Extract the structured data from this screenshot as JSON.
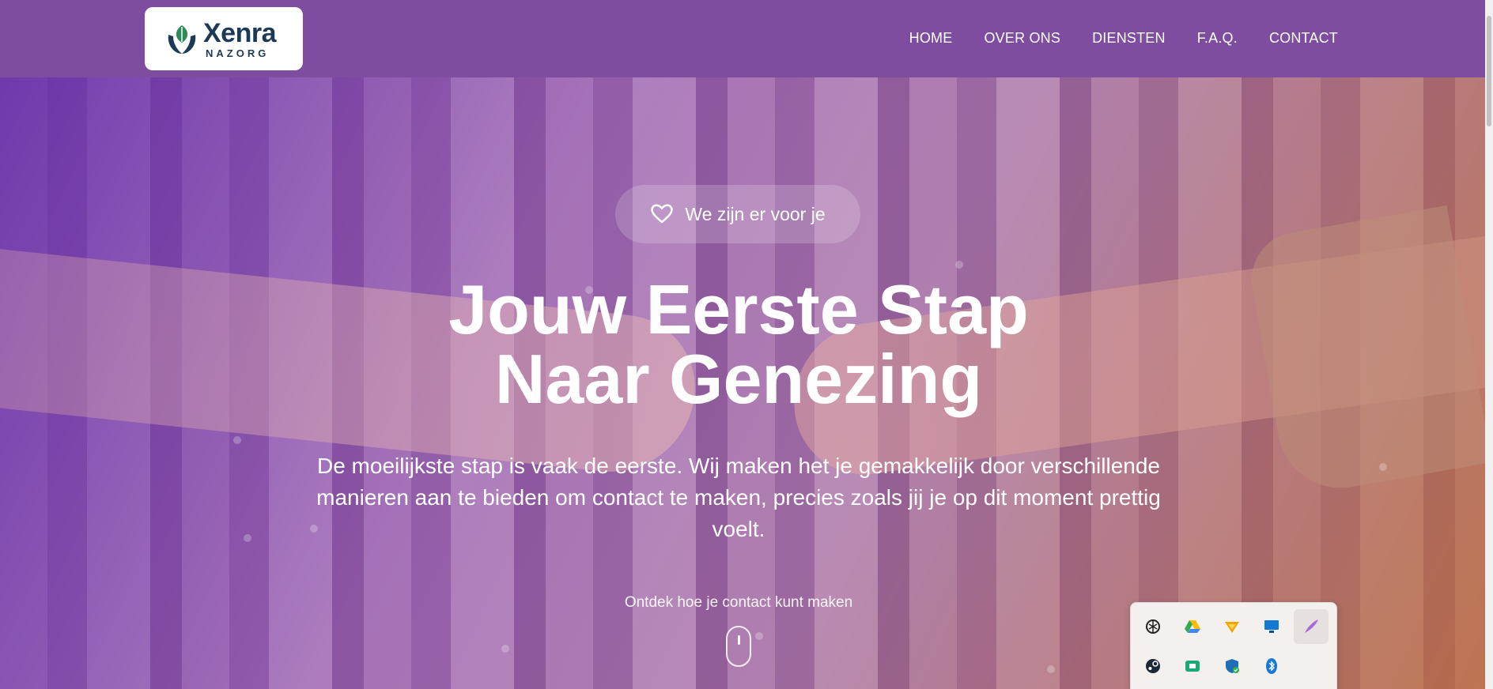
{
  "header": {
    "logo": {
      "name": "Xenra",
      "sub": "NAZORG"
    },
    "nav": [
      {
        "label": "HOME"
      },
      {
        "label": "OVER ONS"
      },
      {
        "label": "DIENSTEN"
      },
      {
        "label": "F.A.Q."
      },
      {
        "label": "CONTACT"
      }
    ]
  },
  "hero": {
    "badge": "We zijn er voor je",
    "title_line1": "Jouw Eerste Stap",
    "title_line2": "Naar Genezing",
    "subtitle": "De moeilijkste stap is vaak de eerste. Wij maken het je gemakkelijk door verschillende manieren aan te bieden om contact te maken, precies zoals jij je op dit moment prettig voelt.",
    "scroll_hint": "Ontdek hoe je contact kunt maken"
  },
  "tray": {
    "icons": [
      "openai-icon",
      "google-drive-icon",
      "feather-app-icon",
      "remote-desktop-icon",
      "quill-icon",
      "steam-icon",
      "wallet-icon",
      "security-shield-icon",
      "bluetooth-icon"
    ]
  },
  "colors": {
    "header_bg": "#7f4da0",
    "logo_text": "#1c3a57",
    "logo_leaf": "#2e8a5a"
  }
}
